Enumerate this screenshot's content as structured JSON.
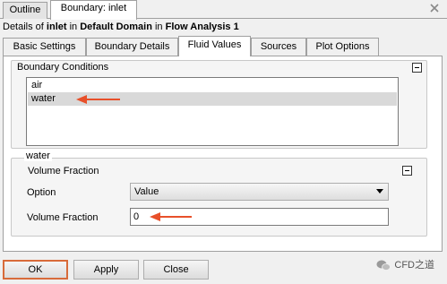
{
  "window": {
    "tabs": [
      {
        "label": "Outline"
      },
      {
        "label": "Boundary: inlet"
      }
    ],
    "close_icon": "close-icon"
  },
  "details": {
    "prefix": "Details of ",
    "object": "inlet",
    "middle": " in ",
    "domain": "Default Domain",
    "middle2": " in ",
    "analysis": "Flow Analysis 1"
  },
  "tabs": [
    {
      "label": "Basic Settings"
    },
    {
      "label": "Boundary Details"
    },
    {
      "label": "Fluid Values"
    },
    {
      "label": "Sources"
    },
    {
      "label": "Plot Options"
    }
  ],
  "active_tab": "Fluid Values",
  "boundary_conditions": {
    "title": "Boundary Conditions",
    "items": [
      "air",
      "water"
    ],
    "selected": "water"
  },
  "fluid_section": {
    "label": "water",
    "group_title": "Volume Fraction",
    "option_label": "Option",
    "option_value": "Value",
    "vf_label": "Volume Fraction",
    "vf_value": "0"
  },
  "buttons": {
    "ok": "OK",
    "apply": "Apply",
    "close": "Close"
  },
  "watermark": {
    "text": "CFD之道",
    "icon": "wechat-icon"
  },
  "colors": {
    "annotation_arrow": "#e8502a",
    "focus_border": "#d86b3a",
    "selection": "#d9d9d9"
  }
}
